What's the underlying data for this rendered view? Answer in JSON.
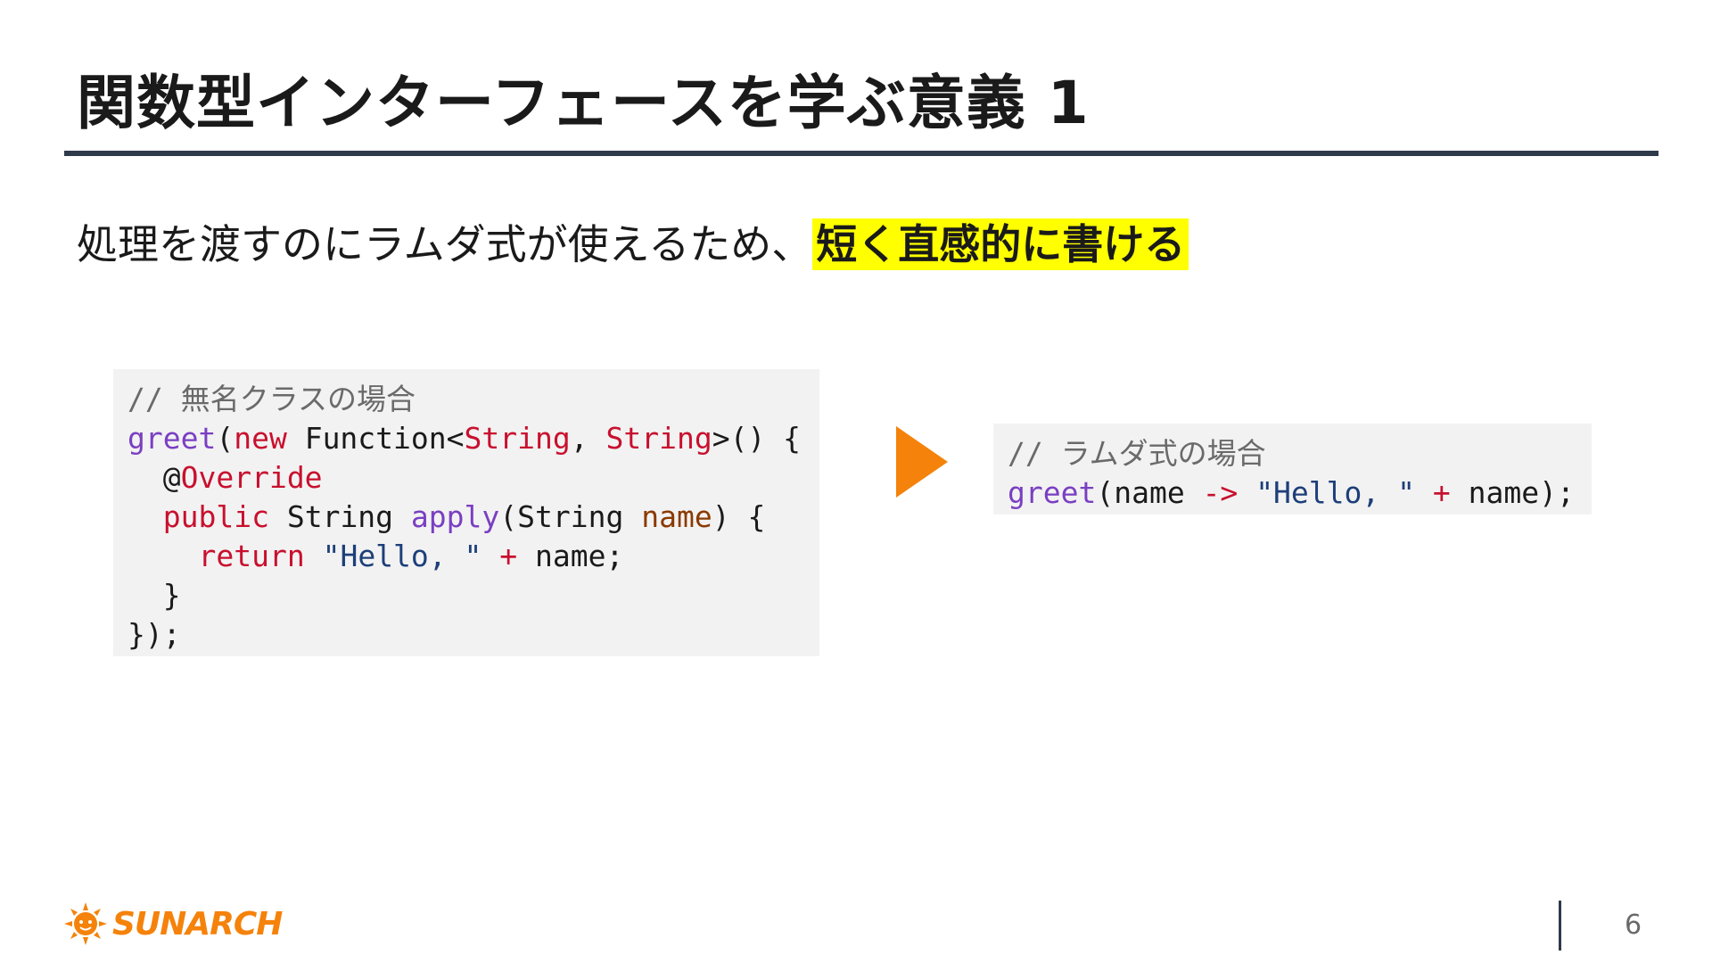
{
  "slide": {
    "title": "関数型インターフェースを学ぶ意義 1",
    "lead_text": "処理を渡すのにラムダ式が使えるため、",
    "lead_highlight": "短く直感的に書ける",
    "page_number": "6"
  },
  "code_left": {
    "l1": "// 無名クラスの場合",
    "l2_fn": "greet",
    "l2_a": "(",
    "l2_kw": "new",
    "l2_b": " Function<",
    "l2_t1": "String",
    "l2_c": ", ",
    "l2_t2": "String",
    "l2_d": ">() {",
    "l3_indent": "  @",
    "l3_kw": "Override",
    "l4_indent": "  ",
    "l4_kw": "public",
    "l4_a": " String ",
    "l4_fn": "apply",
    "l4_b": "(String ",
    "l4_param": "name",
    "l4_c": ") {",
    "l5_indent": "    ",
    "l5_kw": "return",
    "l5_a": " ",
    "l5_str": "\"Hello, \"",
    "l5_op": " + ",
    "l5_b": "name;",
    "l6": "  }",
    "l7": "});"
  },
  "code_right": {
    "l1": "// ラムダ式の場合",
    "l2_fn": "greet",
    "l2_a": "(name ",
    "l2_arrow": "->",
    "l2_b": " ",
    "l2_str": "\"Hello, \"",
    "l2_op": " + ",
    "l2_c": "name);"
  },
  "logo": {
    "text": "SUNARCH",
    "icon": "sun-icon",
    "color": "#f5820a"
  },
  "colors": {
    "highlight": "#ffff00",
    "arrow": "#f5820a",
    "rule": "#2f3a4a"
  }
}
